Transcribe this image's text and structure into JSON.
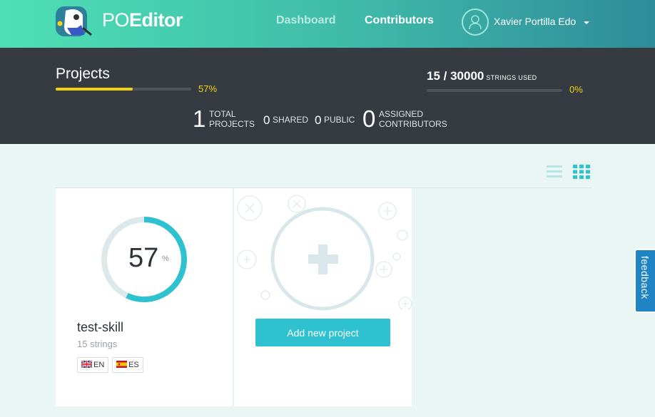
{
  "header": {
    "brand_light": "PO",
    "brand_bold": "Editor",
    "nav": {
      "dashboard": "Dashboard",
      "contributors": "Contributors"
    },
    "user": {
      "name": "Xavier Portilla Edo"
    }
  },
  "stats": {
    "projects_label": "Projects",
    "projects_progress": 0.57,
    "projects_percent": "57%",
    "strings_used": "15 / 30000",
    "strings_used_label": "STRINGS USED",
    "strings_progress": 0,
    "strings_percent": "0%",
    "total_projects": {
      "count": "1",
      "label_line1": "TOTAL",
      "label_line2": "PROJECTS"
    },
    "shared": {
      "count": "0",
      "label": "SHARED"
    },
    "public": {
      "count": "0",
      "label": "PUBLIC"
    },
    "contributors": {
      "count": "0",
      "label_line1": "ASSIGNED",
      "label_line2": "CONTRIBUTORS"
    }
  },
  "projects": [
    {
      "progress": 0.57,
      "percent_value": "57",
      "percent_unit": "%",
      "name": "test-skill",
      "strings": "15 strings",
      "languages": [
        {
          "code": "EN",
          "flag": "uk-flag-icon"
        },
        {
          "code": "ES",
          "flag": "spain-flag-icon"
        }
      ]
    }
  ],
  "add_project": {
    "button_label": "Add new project"
  },
  "feedback": {
    "label": "feedback"
  },
  "colors": {
    "accent": "#2ec2d1",
    "progress": "#f2d311",
    "band": "#353b41"
  }
}
